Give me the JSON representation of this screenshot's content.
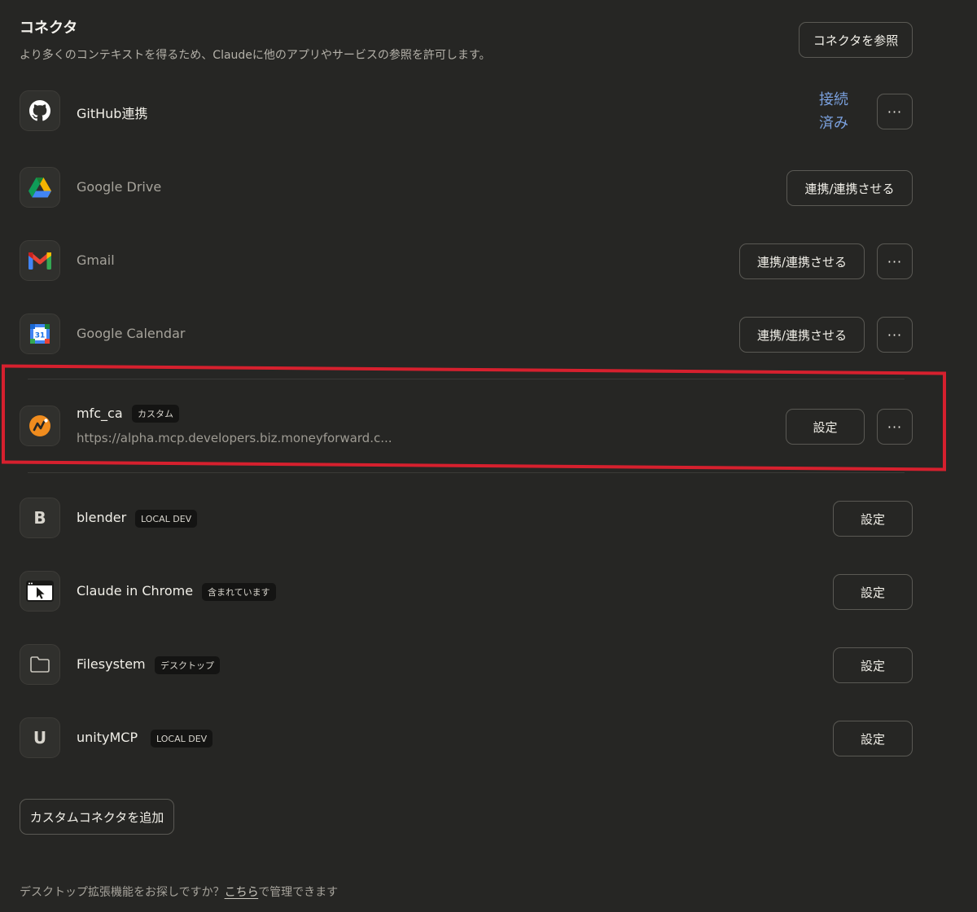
{
  "header": {
    "title": "コネクタ",
    "subtitle": "より多くのコンテキストを得るため、Claudeに他のアプリやサービスの参照を許可します。",
    "browse_button": "コネクタを参照"
  },
  "connectors": [
    {
      "name": "GitHub連携",
      "icon": "github-icon",
      "status_line1": "接続",
      "status_line2": "済み",
      "more": "···"
    },
    {
      "name": "Google Drive",
      "icon": "google-drive-icon",
      "action": "連携/連携させる"
    },
    {
      "name": "Gmail",
      "icon": "gmail-icon",
      "action": "連携/連携させる",
      "more": "···"
    },
    {
      "name": "Google Calendar",
      "icon": "google-calendar-icon",
      "icon_text": "31",
      "action": "連携/連携させる",
      "more": "···"
    },
    {
      "name": "mfc_ca",
      "icon": "money-forward-icon",
      "badge": "カスタム",
      "url": "https://alpha.mcp.developers.biz.moneyforward.c...",
      "action": "設定",
      "more": "···"
    },
    {
      "name": "blender",
      "icon": "letter-b-icon",
      "icon_text": "B",
      "badge": "LOCAL DEV",
      "action": "設定"
    },
    {
      "name": "Claude in Chrome",
      "icon": "browser-cursor-icon",
      "badge": "含まれています",
      "action": "設定"
    },
    {
      "name": "Filesystem",
      "icon": "folder-icon",
      "badge": "デスクトップ",
      "action": "設定"
    },
    {
      "name": "unityMCP",
      "icon": "letter-u-icon",
      "icon_text": "U",
      "badge": "LOCAL DEV",
      "action": "設定"
    }
  ],
  "add_custom_button": "カスタムコネクタを追加",
  "footer": {
    "prefix": "デスクトップ拡張機能をお探しですか？",
    "link": "こちら",
    "suffix": "で管理できます"
  },
  "colors": {
    "background": "#262624",
    "connected": "#7aa0dd",
    "highlight": "#d6202e"
  }
}
